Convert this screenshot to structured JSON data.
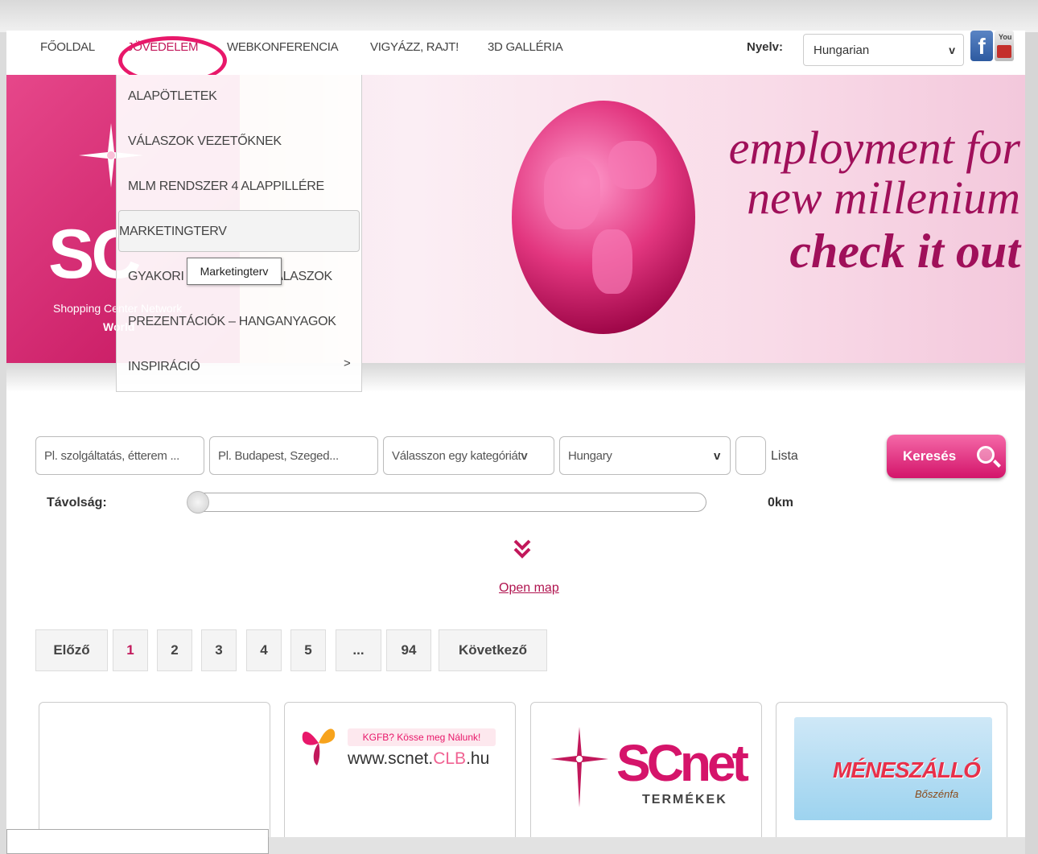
{
  "nav": {
    "items": [
      "FŐOLDAL",
      "JÖVEDELEM",
      "WEBKONFERENCIA",
      "VIGYÁZZ, RAJT!",
      "3D GALLÉRIA"
    ],
    "active_index": 1,
    "language_label": "Nyelv:",
    "language_value": "Hungarian",
    "language_arrow": "v",
    "facebook_glyph": "f",
    "youtube_text": "You"
  },
  "banner": {
    "logo_text": "SC",
    "logo_subtitle": "Shopping Center Network",
    "logo_world": "World",
    "tagline_1": "employment for",
    "tagline_2": "new millenium",
    "tagline_3": "check it out"
  },
  "dropdown": {
    "items": [
      "ALAPÖTLETEK",
      "VÁLASZOK VEZETŐKNEK",
      "MLM RENDSZER 4 ALAPPILLÉRE",
      "MARKETINGTERV",
      "GYAKORI KÉRDÉSEK - VÁLASZOK",
      "PREZENTÁCIÓK – HANGANYAGOK",
      "INSPIRÁCIÓ"
    ],
    "highlighted_index": 3,
    "submenu_arrow": ">",
    "tooltip": "Marketingterv"
  },
  "search": {
    "what_placeholder": "Pl. szolgáltatás, étterem ...",
    "where_placeholder": "Pl. Budapest, Szeged...",
    "category_value": "Válasszon egy kategóriát",
    "category_arrow": "v",
    "country_value": "Hungary",
    "country_arrow": "v",
    "list_label": "Lista",
    "button_label": "Keresés",
    "distance_label": "Távolság:",
    "distance_value": "0km",
    "distance_fraction": 0
  },
  "map": {
    "chevron": "»",
    "open_label": "Open map"
  },
  "pagination": {
    "prev": "Előző",
    "pages": [
      "1",
      "2",
      "3",
      "4",
      "5",
      "...",
      "94"
    ],
    "current": "1",
    "next": "Következő"
  },
  "cards": {
    "kgfb_bubble": "KGFB? Kösse meg Nálunk!",
    "kgfb_url_prefix": "www.scnet.",
    "kgfb_url_clb": "CLB",
    "kgfb_url_suffix": ".hu",
    "scnet_title": "SCnet",
    "scnet_subtitle": "TERMÉKEK",
    "horse_title": "MÉNESZÁLLÓ",
    "horse_subtitle": "Bőszénfa"
  },
  "colors": {
    "accent": "#c2185b",
    "brand_pink": "#e8186a"
  }
}
